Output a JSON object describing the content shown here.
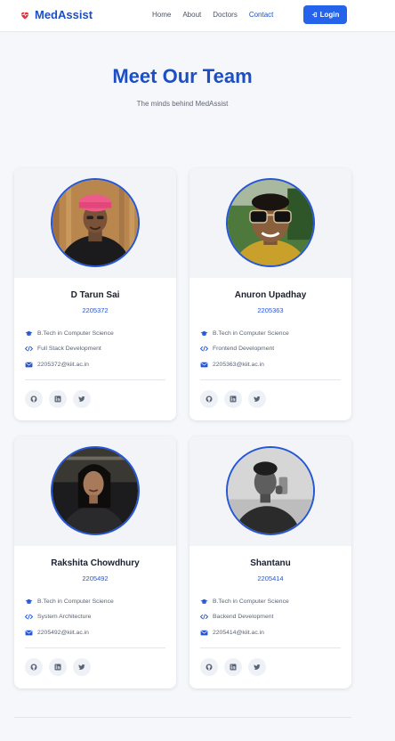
{
  "brand": {
    "name": "MedAssist",
    "icon": "heart-pulse-icon",
    "color": "#1d4fc4"
  },
  "nav": {
    "links": [
      {
        "label": "Home",
        "active": false
      },
      {
        "label": "About",
        "active": false
      },
      {
        "label": "Doctors",
        "active": false
      },
      {
        "label": "Contact",
        "active": true
      }
    ],
    "login_label": "Login",
    "login_icon": "sign-in-icon"
  },
  "hero": {
    "title": "Meet Our Team",
    "subtitle": "The minds behind MedAssist"
  },
  "team": [
    {
      "name": "D Tarun Sai",
      "id": "2205372",
      "degree": "B.Tech in Computer Science",
      "role": "Full Stack Development",
      "email": "2205372@kiit.ac.in"
    },
    {
      "name": "Anuron Upadhay",
      "id": "2205363",
      "degree": "B.Tech in Computer Science",
      "role": "Frontend Development",
      "email": "2205363@kiit.ac.in"
    },
    {
      "name": "Rakshita Chowdhury",
      "id": "2205492",
      "degree": "B.Tech in Computer Science",
      "role": "System Architecture",
      "email": "2205492@kiit.ac.in"
    },
    {
      "name": "Shantanu",
      "id": "2205414",
      "degree": "B.Tech in Computer Science",
      "role": "Backend Development",
      "email": "2205414@kiit.ac.in"
    }
  ],
  "social_icons": [
    "github-icon",
    "linkedin-icon",
    "twitter-icon"
  ],
  "colors": {
    "accent": "#2563eb",
    "heading": "#1d4fc4",
    "background": "#f6f7fa"
  }
}
